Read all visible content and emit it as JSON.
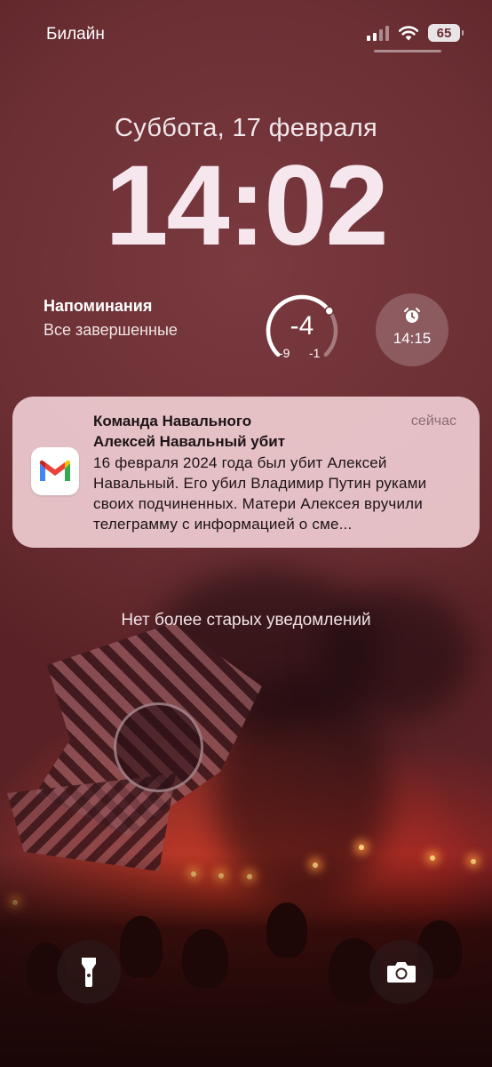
{
  "status_bar": {
    "carrier": "Билайн",
    "battery": "65"
  },
  "lock": {
    "date": "Суббота, 17 февраля",
    "time": "14:02"
  },
  "widgets": {
    "reminders": {
      "title": "Напоминания",
      "subtitle": "Все завершенные"
    },
    "weather": {
      "current": "-4",
      "low": "-9",
      "high": "-1",
      "gauge_fraction": 0.7
    },
    "alarm": {
      "time": "14:15"
    }
  },
  "notification": {
    "app_icon": "gmail-icon",
    "sender": "Команда Навального",
    "subject": "Алексей Навальный убит",
    "time": "сейчас",
    "body": "16 февраля 2024 года был убит Алексей Навальный. Его убил Владимир Путин руками своих подчиненных. Матери Алексея вручили телеграмму с информацией о сме..."
  },
  "no_older": "Нет более старых уведомлений",
  "quick_actions": {
    "left": "flashlight-icon",
    "right": "camera-icon"
  },
  "colors": {
    "notification_bg": "#f2d0d6",
    "widget_text": "#ffffff",
    "weather_gauge": "#ffffff"
  }
}
